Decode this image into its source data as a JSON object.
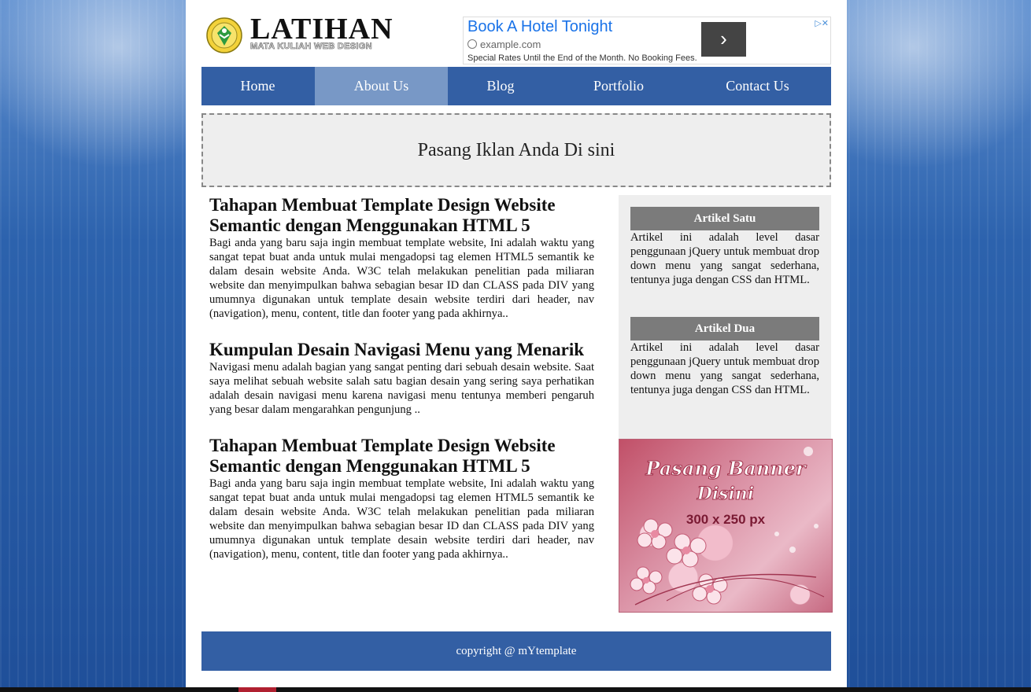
{
  "header": {
    "title": "LATIHAN",
    "subtitle": "MATA KULIAH WEB DESIGN"
  },
  "ad": {
    "title": "Book A Hotel Tonight",
    "url": "example.com",
    "description": "Special Rates Until the End of the Month. No Booking Fees.",
    "go_icon": "chevron-right-icon",
    "choices_icon": "ad-choices-icon"
  },
  "nav": {
    "items": [
      {
        "label": "Home"
      },
      {
        "label": "About Us"
      },
      {
        "label": "Blog"
      },
      {
        "label": "Portfolio"
      },
      {
        "label": "Contact Us"
      }
    ],
    "active_index": 1
  },
  "promo": {
    "text": "Pasang Iklan Anda Di sini"
  },
  "articles": [
    {
      "title": "Tahapan Membuat Template Design Website Semantic dengan Menggunakan HTML 5",
      "body": "Bagi anda yang baru saja ingin membuat template website, Ini adalah waktu yang sangat tepat buat anda untuk mulai mengadopsi tag elemen HTML5 semantik ke dalam desain website Anda. W3C telah melakukan penelitian pada miliaran website dan menyimpulkan bahwa sebagian besar ID dan CLASS pada DIV yang umumnya digunakan untuk template desain website terdiri dari header, nav (navigation), menu, content, title dan footer yang pada akhirnya.."
    },
    {
      "title": "Kumpulan Desain Navigasi Menu yang Menarik",
      "body": "Navigasi menu adalah bagian yang sangat penting dari sebuah desain website. Saat saya melihat sebuah website salah satu bagian desain yang sering saya perhatikan adalah desain navigasi menu karena navigasi menu tentunya memberi pengaruh yang besar dalam mengarahkan pengunjung .."
    },
    {
      "title": "Tahapan Membuat Template Design Website Semantic dengan Menggunakan HTML 5",
      "body": "Bagi anda yang baru saja ingin membuat template website, Ini adalah waktu yang sangat tepat buat anda untuk mulai mengadopsi tag elemen HTML5 semantik ke dalam desain website Anda. W3C telah melakukan penelitian pada miliaran website dan menyimpulkan bahwa sebagian besar ID dan CLASS pada DIV yang umumnya digunakan untuk template desain website terdiri dari header, nav (navigation), menu, content, title dan footer yang pada akhirnya.."
    }
  ],
  "sidebar": {
    "widgets": [
      {
        "title": "Artikel Satu",
        "text": "Artikel ini adalah level dasar penggunaan jQuery untuk membuat drop down menu yang sangat sederhana, tentunya juga dengan CSS dan HTML."
      },
      {
        "title": "Artikel Dua",
        "text": "Artikel ini adalah level dasar penggunaan jQuery untuk membuat drop down menu yang sangat sederhana, tentunya juga dengan CSS dan HTML."
      }
    ],
    "banner": {
      "line1": "Pasang Banner",
      "line2": "Disini",
      "size": "300 x 250 px"
    }
  },
  "footer": {
    "text": "copyright @ mYtemplate"
  },
  "colors": {
    "nav_bg": "#335fa4",
    "nav_active": "#7898c6",
    "widget_title_bg": "#7b7b7b",
    "ad_title": "#1a73e8"
  }
}
